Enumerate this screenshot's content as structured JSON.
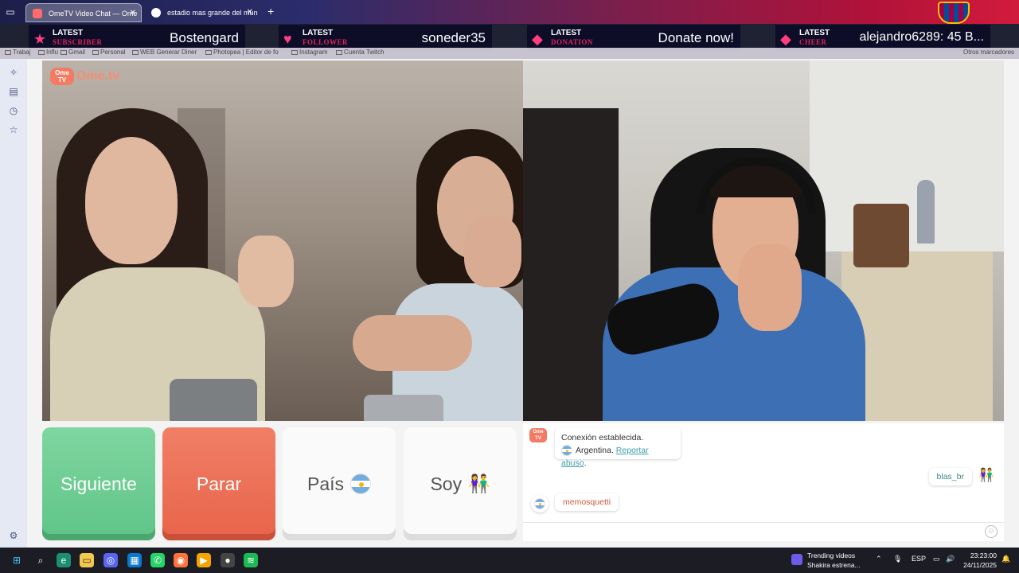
{
  "browser": {
    "tabs": [
      {
        "title": "OmeTV Video Chat — Ome",
        "active": true
      },
      {
        "title": "estadio mas grande del mundo",
        "active": false
      }
    ],
    "new_tab": "+",
    "bookmarks": [
      "Trabaj",
      "Influ",
      "Gmail",
      "Personal",
      "WEB Generar Diner",
      "Photopea | Editor de fo",
      "Instagram",
      "Cuenta Twitch",
      "Otros marcadores"
    ]
  },
  "stream_alerts": [
    {
      "line1": "LATEST",
      "line2": "SUBSCRIBER",
      "value": "Bostengard",
      "icon": "star"
    },
    {
      "line1": "LATEST",
      "line2": "FOLLOWER",
      "value": "soneder35",
      "icon": "heart"
    },
    {
      "line1": "LATEST",
      "line2": "DONATION",
      "value": "Donate now!",
      "icon": "diamond"
    },
    {
      "line1": "LATEST",
      "line2": "CHEER",
      "value": "alejandro6289: 45 B...",
      "icon": "diamond"
    }
  ],
  "site": {
    "logo_bubble": "Ome TV",
    "logo_word": "Ome.tv"
  },
  "controls": {
    "next": "Siguiente",
    "stop": "Parar",
    "country": "País",
    "gender": "Soy"
  },
  "chat": {
    "system": {
      "line1": "Conexión establecida.",
      "country": "Argentina.",
      "report": "Reportar abuso",
      "report_suffix": "."
    },
    "self_message": "blas_br",
    "peer_message": "memosquetti",
    "input_value": ""
  },
  "taskbar": {
    "news_title": "Trending videos",
    "news_sub": "Shakira estrena...",
    "language": "ESP",
    "time": "23:23:00",
    "date": "24/11/2025"
  },
  "colors": {
    "next_green": "#5fc487",
    "stop_red": "#e8644a",
    "accent_teal": "#3d9fa8",
    "logo_orange": "#f47b63"
  }
}
